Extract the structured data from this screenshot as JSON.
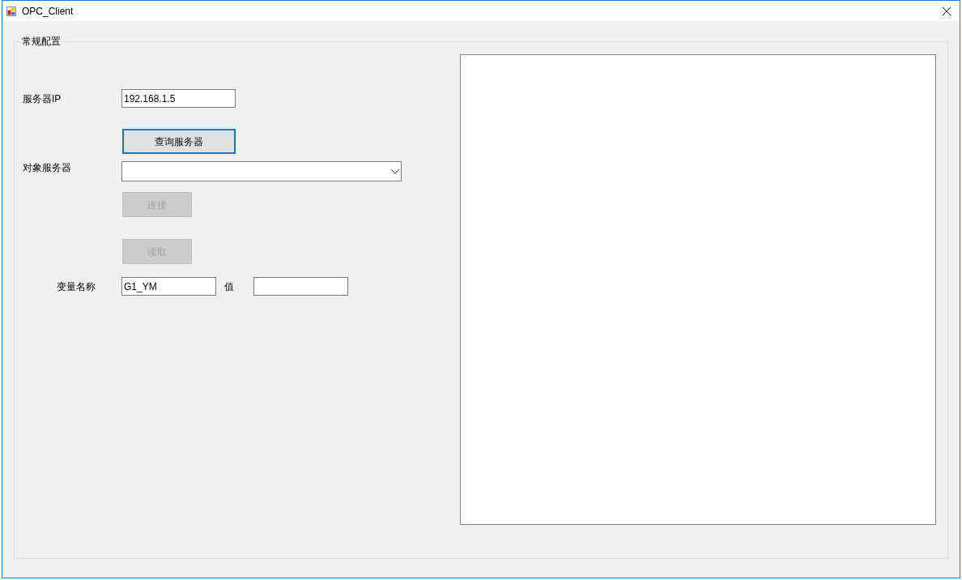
{
  "window": {
    "title": "OPC_Client"
  },
  "group_box": {
    "title": "常规配置"
  },
  "server_ip": {
    "label": "服务器IP",
    "value": "192.168.1.5"
  },
  "query_button": {
    "label": "查询服务器",
    "focused": true,
    "disabled": false
  },
  "target_server": {
    "label": "对象服务器"
  },
  "connect_button": {
    "label": "连接",
    "focused": false,
    "disabled": true
  },
  "read_button": {
    "label": "读取",
    "focused": false,
    "disabled": true
  },
  "variable_name": {
    "label": "变量名称",
    "value": "G1_YM"
  },
  "variable_value": {
    "label": "值"
  }
}
